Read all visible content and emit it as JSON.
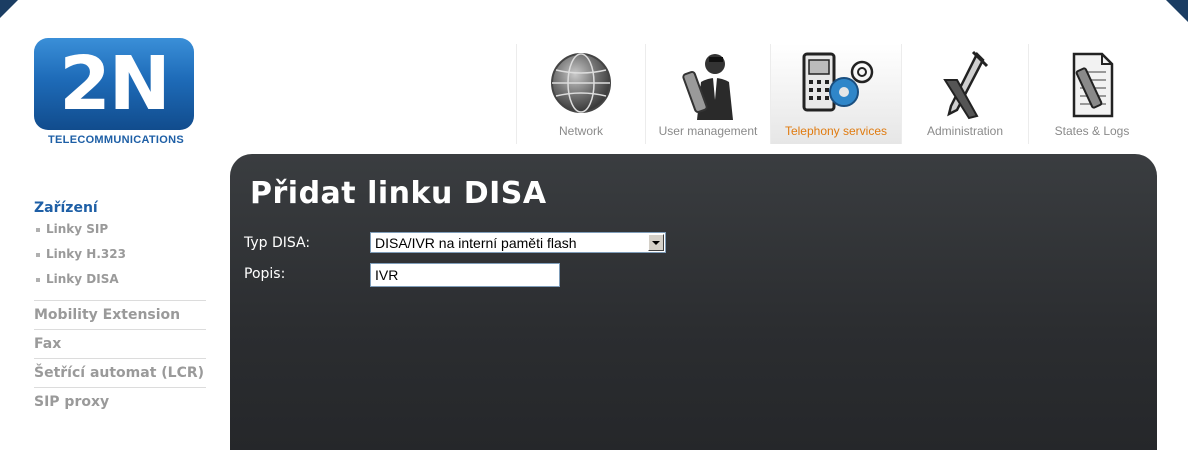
{
  "logo": {
    "mark": "2N",
    "subtitle": "TELECOMMUNICATIONS"
  },
  "nav": [
    {
      "label": "Network",
      "icon": "globe-icon",
      "active": false
    },
    {
      "label": "User management",
      "icon": "user-management-icon",
      "active": false
    },
    {
      "label": "Telephony services",
      "icon": "telephony-services-icon",
      "active": true
    },
    {
      "label": "Administration",
      "icon": "administration-tools-icon",
      "active": false
    },
    {
      "label": "States & Logs",
      "icon": "logs-document-icon",
      "active": false
    }
  ],
  "sidebar": {
    "heading": "Zařízení",
    "subitems": [
      "Linky SIP",
      "Linky H.323",
      "Linky DISA"
    ],
    "items": [
      "Mobility Extension",
      "Fax",
      "Šetřící automat (LCR)",
      "SIP proxy"
    ]
  },
  "panel": {
    "title": "Přidat linku DISA",
    "typ_label": "Typ DISA:",
    "typ_value": "DISA/IVR na interní paměti flash",
    "popis_label": "Popis:",
    "popis_value": "IVR"
  },
  "colors": {
    "brand_blue": "#1e5fa6",
    "active_orange": "#e07b10",
    "panel_bg": "#2b2d30"
  }
}
